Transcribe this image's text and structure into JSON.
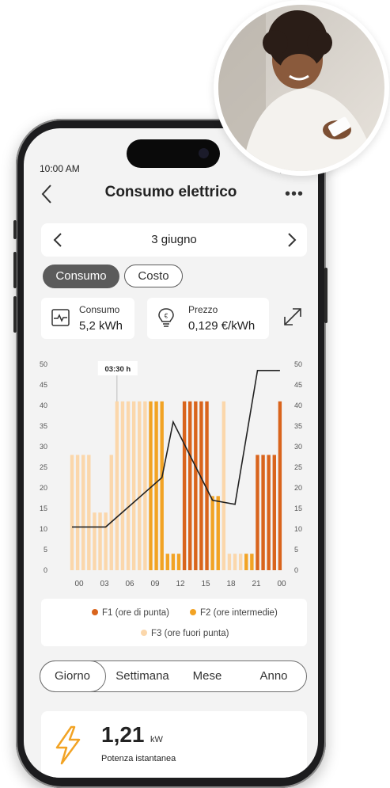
{
  "status": {
    "time": "10:00 AM"
  },
  "header": {
    "title": "Consumo elettrico"
  },
  "datebar": {
    "date": "3 giugno"
  },
  "view_toggle": {
    "active": "Consumo",
    "inactive": "Costo"
  },
  "cards": {
    "consumption": {
      "label": "Consumo",
      "value": "5,2 kWh"
    },
    "price": {
      "label": "Prezzo",
      "value": "0,129 €/kWh"
    }
  },
  "chart_data": {
    "type": "bar",
    "tooltip": "03:30 h",
    "x_tick_labels": [
      "00",
      "03",
      "06",
      "09",
      "12",
      "15",
      "18",
      "21",
      "00"
    ],
    "y_ticks": [
      0,
      5,
      10,
      15,
      20,
      25,
      30,
      35,
      40,
      45,
      50
    ],
    "ylim": [
      0,
      50
    ],
    "bar_hours": [
      0,
      1,
      2,
      3,
      4,
      5,
      6,
      7,
      8,
      9,
      10,
      11,
      12,
      13,
      14,
      15,
      16,
      17,
      18,
      19,
      20,
      21,
      22,
      23
    ],
    "series": [
      {
        "name": "F1 (ore di punta)",
        "color": "#d9641c",
        "values": [
          0,
          0,
          0,
          0,
          0,
          0,
          0,
          0,
          0,
          0,
          0,
          0,
          0,
          0,
          0,
          0,
          0,
          0,
          0,
          0,
          0,
          0,
          0,
          0
        ]
      },
      {
        "name": "F2 (ore intermedie)",
        "color": "#f2a324",
        "values": [
          0,
          0,
          0,
          0,
          0,
          0,
          0,
          0,
          0,
          0,
          0,
          0,
          0,
          0,
          0,
          0,
          0,
          0,
          0,
          0,
          0,
          0,
          0,
          0
        ]
      },
      {
        "name": "F3 (ore fuori punta)",
        "color": "#fbd7ab",
        "values": [
          0,
          0,
          0,
          0,
          0,
          0,
          0,
          0,
          0,
          0,
          0,
          0,
          0,
          0,
          0,
          0,
          0,
          0,
          0,
          0,
          0,
          0,
          0,
          0
        ]
      }
    ],
    "bars": [
      {
        "t": 0.0,
        "v": 28,
        "band": "F3"
      },
      {
        "t": 0.5,
        "v": 28,
        "band": "F3"
      },
      {
        "t": 1.0,
        "v": 28,
        "band": "F3"
      },
      {
        "t": 1.5,
        "v": 28,
        "band": "F3"
      },
      {
        "t": 2.0,
        "v": 14,
        "band": "F3"
      },
      {
        "t": 2.5,
        "v": 14,
        "band": "F3"
      },
      {
        "t": 3.0,
        "v": 14,
        "band": "F3"
      },
      {
        "t": 3.5,
        "v": 28,
        "band": "F3"
      },
      {
        "t": 4.0,
        "v": 41,
        "band": "F3"
      },
      {
        "t": 4.5,
        "v": 41,
        "band": "F3"
      },
      {
        "t": 5.0,
        "v": 41,
        "band": "F3"
      },
      {
        "t": 5.5,
        "v": 41,
        "band": "F3"
      },
      {
        "t": 6.0,
        "v": 41,
        "band": "F3"
      },
      {
        "t": 6.5,
        "v": 41,
        "band": "F3"
      },
      {
        "t": 7.0,
        "v": 41,
        "band": "F2"
      },
      {
        "t": 7.5,
        "v": 41,
        "band": "F2"
      },
      {
        "t": 8.0,
        "v": 41,
        "band": "F2"
      },
      {
        "t": 8.5,
        "v": 4,
        "band": "F2"
      },
      {
        "t": 9.0,
        "v": 4,
        "band": "F2"
      },
      {
        "t": 9.5,
        "v": 4,
        "band": "F2"
      },
      {
        "t": 10.0,
        "v": 41,
        "band": "F1"
      },
      {
        "t": 10.5,
        "v": 41,
        "band": "F1"
      },
      {
        "t": 11.0,
        "v": 41,
        "band": "F1"
      },
      {
        "t": 11.5,
        "v": 41,
        "band": "F1"
      },
      {
        "t": 12.0,
        "v": 41,
        "band": "F1"
      },
      {
        "t": 12.5,
        "v": 18,
        "band": "F2"
      },
      {
        "t": 13.0,
        "v": 18,
        "band": "F2"
      },
      {
        "t": 13.5,
        "v": 41,
        "band": "F3"
      },
      {
        "t": 14.0,
        "v": 4,
        "band": "F3"
      },
      {
        "t": 14.5,
        "v": 4,
        "band": "F3"
      },
      {
        "t": 15.0,
        "v": 4,
        "band": "F3"
      },
      {
        "t": 15.5,
        "v": 4,
        "band": "F2"
      },
      {
        "t": 16.0,
        "v": 4,
        "band": "F2"
      },
      {
        "t": 16.5,
        "v": 28,
        "band": "F1"
      },
      {
        "t": 17.0,
        "v": 28,
        "band": "F1"
      },
      {
        "t": 17.5,
        "v": 28,
        "band": "F1"
      },
      {
        "t": 18.0,
        "v": 28,
        "band": "F1"
      },
      {
        "t": 18.5,
        "v": 41,
        "band": "F1"
      }
    ],
    "line": [
      {
        "t": 0.0,
        "v": 10.5
      },
      {
        "t": 3.0,
        "v": 10.5
      },
      {
        "t": 8.0,
        "v": 22.5
      },
      {
        "t": 9.0,
        "v": 36
      },
      {
        "t": 12.5,
        "v": 17
      },
      {
        "t": 14.5,
        "v": 16
      },
      {
        "t": 16.5,
        "v": 48.5
      },
      {
        "t": 18.5,
        "v": 48.5
      }
    ]
  },
  "legend": {
    "f1": "F1 (ore di punta)",
    "f2": "F2 (ore intermedie)",
    "f3": "F3 (ore fuori punta)",
    "colors": {
      "f1": "#d9641c",
      "f2": "#f2a324",
      "f3": "#fbd7ab"
    }
  },
  "period_tabs": [
    "Giorno",
    "Settimana",
    "Mese",
    "Anno"
  ],
  "power": {
    "value": "1,21",
    "unit": "kW",
    "caption": "Potenza istantanea"
  },
  "colors": {
    "accent": "#f2a324",
    "dark_button": "#5b5b5b",
    "line": "#222222"
  }
}
